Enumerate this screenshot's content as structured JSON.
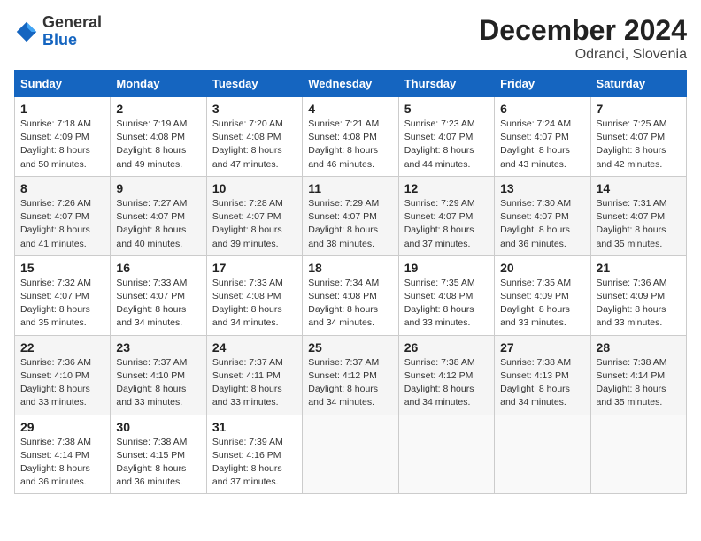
{
  "header": {
    "logo_line1": "General",
    "logo_line2": "Blue",
    "month_title": "December 2024",
    "location": "Odranci, Slovenia"
  },
  "weekdays": [
    "Sunday",
    "Monday",
    "Tuesday",
    "Wednesday",
    "Thursday",
    "Friday",
    "Saturday"
  ],
  "weeks": [
    [
      {
        "day": "1",
        "sunrise": "7:18 AM",
        "sunset": "4:09 PM",
        "daylight": "8 hours and 50 minutes."
      },
      {
        "day": "2",
        "sunrise": "7:19 AM",
        "sunset": "4:08 PM",
        "daylight": "8 hours and 49 minutes."
      },
      {
        "day": "3",
        "sunrise": "7:20 AM",
        "sunset": "4:08 PM",
        "daylight": "8 hours and 47 minutes."
      },
      {
        "day": "4",
        "sunrise": "7:21 AM",
        "sunset": "4:08 PM",
        "daylight": "8 hours and 46 minutes."
      },
      {
        "day": "5",
        "sunrise": "7:23 AM",
        "sunset": "4:07 PM",
        "daylight": "8 hours and 44 minutes."
      },
      {
        "day": "6",
        "sunrise": "7:24 AM",
        "sunset": "4:07 PM",
        "daylight": "8 hours and 43 minutes."
      },
      {
        "day": "7",
        "sunrise": "7:25 AM",
        "sunset": "4:07 PM",
        "daylight": "8 hours and 42 minutes."
      }
    ],
    [
      {
        "day": "8",
        "sunrise": "7:26 AM",
        "sunset": "4:07 PM",
        "daylight": "8 hours and 41 minutes."
      },
      {
        "day": "9",
        "sunrise": "7:27 AM",
        "sunset": "4:07 PM",
        "daylight": "8 hours and 40 minutes."
      },
      {
        "day": "10",
        "sunrise": "7:28 AM",
        "sunset": "4:07 PM",
        "daylight": "8 hours and 39 minutes."
      },
      {
        "day": "11",
        "sunrise": "7:29 AM",
        "sunset": "4:07 PM",
        "daylight": "8 hours and 38 minutes."
      },
      {
        "day": "12",
        "sunrise": "7:29 AM",
        "sunset": "4:07 PM",
        "daylight": "8 hours and 37 minutes."
      },
      {
        "day": "13",
        "sunrise": "7:30 AM",
        "sunset": "4:07 PM",
        "daylight": "8 hours and 36 minutes."
      },
      {
        "day": "14",
        "sunrise": "7:31 AM",
        "sunset": "4:07 PM",
        "daylight": "8 hours and 35 minutes."
      }
    ],
    [
      {
        "day": "15",
        "sunrise": "7:32 AM",
        "sunset": "4:07 PM",
        "daylight": "8 hours and 35 minutes."
      },
      {
        "day": "16",
        "sunrise": "7:33 AM",
        "sunset": "4:07 PM",
        "daylight": "8 hours and 34 minutes."
      },
      {
        "day": "17",
        "sunrise": "7:33 AM",
        "sunset": "4:08 PM",
        "daylight": "8 hours and 34 minutes."
      },
      {
        "day": "18",
        "sunrise": "7:34 AM",
        "sunset": "4:08 PM",
        "daylight": "8 hours and 34 minutes."
      },
      {
        "day": "19",
        "sunrise": "7:35 AM",
        "sunset": "4:08 PM",
        "daylight": "8 hours and 33 minutes."
      },
      {
        "day": "20",
        "sunrise": "7:35 AM",
        "sunset": "4:09 PM",
        "daylight": "8 hours and 33 minutes."
      },
      {
        "day": "21",
        "sunrise": "7:36 AM",
        "sunset": "4:09 PM",
        "daylight": "8 hours and 33 minutes."
      }
    ],
    [
      {
        "day": "22",
        "sunrise": "7:36 AM",
        "sunset": "4:10 PM",
        "daylight": "8 hours and 33 minutes."
      },
      {
        "day": "23",
        "sunrise": "7:37 AM",
        "sunset": "4:10 PM",
        "daylight": "8 hours and 33 minutes."
      },
      {
        "day": "24",
        "sunrise": "7:37 AM",
        "sunset": "4:11 PM",
        "daylight": "8 hours and 33 minutes."
      },
      {
        "day": "25",
        "sunrise": "7:37 AM",
        "sunset": "4:12 PM",
        "daylight": "8 hours and 34 minutes."
      },
      {
        "day": "26",
        "sunrise": "7:38 AM",
        "sunset": "4:12 PM",
        "daylight": "8 hours and 34 minutes."
      },
      {
        "day": "27",
        "sunrise": "7:38 AM",
        "sunset": "4:13 PM",
        "daylight": "8 hours and 34 minutes."
      },
      {
        "day": "28",
        "sunrise": "7:38 AM",
        "sunset": "4:14 PM",
        "daylight": "8 hours and 35 minutes."
      }
    ],
    [
      {
        "day": "29",
        "sunrise": "7:38 AM",
        "sunset": "4:14 PM",
        "daylight": "8 hours and 36 minutes."
      },
      {
        "day": "30",
        "sunrise": "7:38 AM",
        "sunset": "4:15 PM",
        "daylight": "8 hours and 36 minutes."
      },
      {
        "day": "31",
        "sunrise": "7:39 AM",
        "sunset": "4:16 PM",
        "daylight": "8 hours and 37 minutes."
      },
      null,
      null,
      null,
      null
    ]
  ]
}
